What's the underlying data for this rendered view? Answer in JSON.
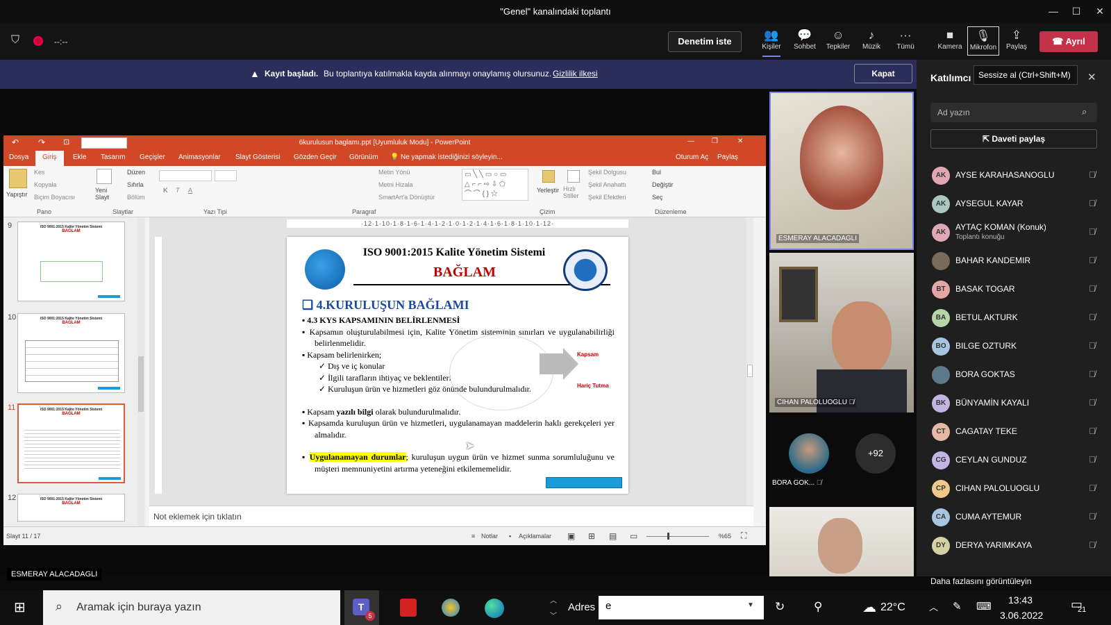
{
  "window": {
    "title": "\"Genel\" kanalındaki toplantı",
    "minimize": "—",
    "maximize": "☐",
    "close": "✕"
  },
  "toolbar": {
    "timer": "--:--",
    "request_control": "Denetim iste",
    "people": "Kişiler",
    "chat": "Sohbet",
    "reactions": "Tepkiler",
    "music": "Müzik",
    "more": "Tümü",
    "camera": "Kamera",
    "mic": "Mikrofon",
    "share": "Paylaş",
    "leave": "Ayrıl",
    "tooltip": "Sessize al (Ctrl+Shift+M)"
  },
  "banner": {
    "bold": "Kayıt başladı.",
    "text": "Bu toplantıya katılmakla kayda alınmayı onaylamış olursunuz.",
    "link": "Gizlilik ilkesi",
    "close": "Kapat"
  },
  "ppt": {
    "title": "6kurulusun baglamı.ppt [Uyumluluk Modu] - PowerPoint",
    "tabs": [
      "Dosya",
      "Giriş",
      "Ekle",
      "Tasarım",
      "Geçişler",
      "Animasyonlar",
      "Slayt Gösterisi",
      "Gözden Geçir",
      "Görünüm"
    ],
    "tellme": "Ne yapmak istediğinizi söyleyin...",
    "signin": "Oturum Aç",
    "share": "Paylaş",
    "ribbon": {
      "paste": "Yapıştır",
      "cut": "Kes",
      "copy": "Kopyala",
      "format": "Biçim Boyacısı",
      "new_slide": "Yeni Slayt",
      "layout": "Düzen",
      "reset": "Sıfırla",
      "section": "Bölüm",
      "text_dir": "Metin Yönü",
      "align_text": "Metni Hizala",
      "smartart": "SmartArt'a Dönüştür",
      "arrange": "Yerleştir",
      "quick_styles": "Hızlı Stiller",
      "shape_fill": "Şekil Dolgusu",
      "shape_outline": "Şekil Anahattı",
      "shape_effects": "Şekil Efektleri",
      "find": "Bul",
      "replace": "Değiştir",
      "select": "Seç",
      "groups": [
        "Pano",
        "Slaytlar",
        "Yazı Tipi",
        "Paragraf",
        "Çizim",
        "Düzenleme"
      ]
    },
    "ruler": "·12·1·10·1·8·1·6·1·4·1·2·1·0·1·2·1·4·1·6·1·8·1·10·1·12·",
    "thumb_nums": [
      "9",
      "10",
      "11",
      "12"
    ],
    "thumb_header": "ISO 9001:2015 Kalite Yönetim Sistemi",
    "thumb_sub": "BAĞLAM",
    "slide": {
      "header": "ISO 9001:2015 Kalite Yönetim Sistemi",
      "sub": "BAĞLAM",
      "heading": "4.KURULUŞUN BAĞLAMI",
      "b1": "4.3 KYS KAPSAMININ BELİRLENMESİ",
      "b2": "Kapsamın oluşturulabilmesi için, Kalite Yönetim sisteminin sınırları ve uygulanabilirliği belirlenmelidir.",
      "b3": "Kapsam belirlenirken;",
      "c1": "Dış ve iç konular",
      "c2": "İlgili tarafların ihtiyaç ve beklentileri",
      "c3": "Kuruluşun ürün ve hizmetleri göz önünde bulundurulmalıdır.",
      "arrow1": "Kapsam",
      "arrow2": "Hariç Tutma",
      "b4a": "Kapsam ",
      "b4b": "yazılı bilgi",
      "b4c": " olarak bulundurulmalıdır.",
      "b5": "Kapsamda kuruluşun ürün ve hizmetleri, uygulanamayan maddelerin haklı gerekçeleri yer almalıdır.",
      "b6a": "Uygulanamayan durumlar",
      "b6b": "; kuruluşun uygun ürün ve hizmet sunma sorumluluğunu ve müşteri memnuniyetini artırma yeteneğini etkilememelidir."
    },
    "notes": "Not eklemek için tıklatın",
    "status": {
      "slide": "Slayt 11 / 17",
      "notes": "Notlar",
      "comments": "Açıklamalar",
      "zoom": "%65"
    }
  },
  "videos": {
    "v1": "ESMERAY ALACADAGLI",
    "v2": "CIHAN PALOLUOGLU",
    "v3": "BORA GOK...",
    "more": "+92",
    "presenter": "ESMERAY ALACADAGLI"
  },
  "panel": {
    "title": "Katılımcı",
    "search": "Ad yazın",
    "invite": "Daveti paylaş",
    "more": "Daha fazlasını görüntüleyin",
    "people": [
      {
        "i": "AK",
        "n": "AYSE KARAHASANOGLU",
        "c": "#e0a8b2"
      },
      {
        "i": "AK",
        "n": "AYSEGUL KAYAR",
        "c": "#a9c9c0"
      },
      {
        "i": "AK",
        "n": "AYTAÇ KOMAN (Konuk)",
        "s": "Toplantı konuğu",
        "c": "#e0a8b2"
      },
      {
        "i": "",
        "n": "BAHAR KANDEMIR",
        "c": "#7a6a5c"
      },
      {
        "i": "BT",
        "n": "BASAK TOGAR",
        "c": "#e6a6a6"
      },
      {
        "i": "BA",
        "n": "BETUL AKTURK",
        "c": "#b5d6a7"
      },
      {
        "i": "BO",
        "n": "BILGE OZTURK",
        "c": "#a7c5e0"
      },
      {
        "i": "",
        "n": "BORA GOKTAS",
        "c": "#5c7a8c"
      },
      {
        "i": "BK",
        "n": "BÜNYAMİN KAYALI",
        "c": "#c3b5e3"
      },
      {
        "i": "CT",
        "n": "CAGATAY TEKE",
        "c": "#e6b8a6"
      },
      {
        "i": "CG",
        "n": "CEYLAN GUNDUZ",
        "c": "#c3b5e3"
      },
      {
        "i": "CP",
        "n": "CIHAN PALOLUOGLU",
        "c": "#f0c88a"
      },
      {
        "i": "CA",
        "n": "CUMA AYTEMUR",
        "c": "#a7c5e0"
      },
      {
        "i": "DY",
        "n": "DERYA YARIMKAYA",
        "c": "#d6d0a7"
      }
    ]
  },
  "taskbar": {
    "search": "Aramak için buraya yazın",
    "teams_badge": "5",
    "address_label": "Adres",
    "address_value": "e",
    "temp": "22°C",
    "time": "13:43",
    "date": "3.06.2022",
    "notif": "21"
  }
}
